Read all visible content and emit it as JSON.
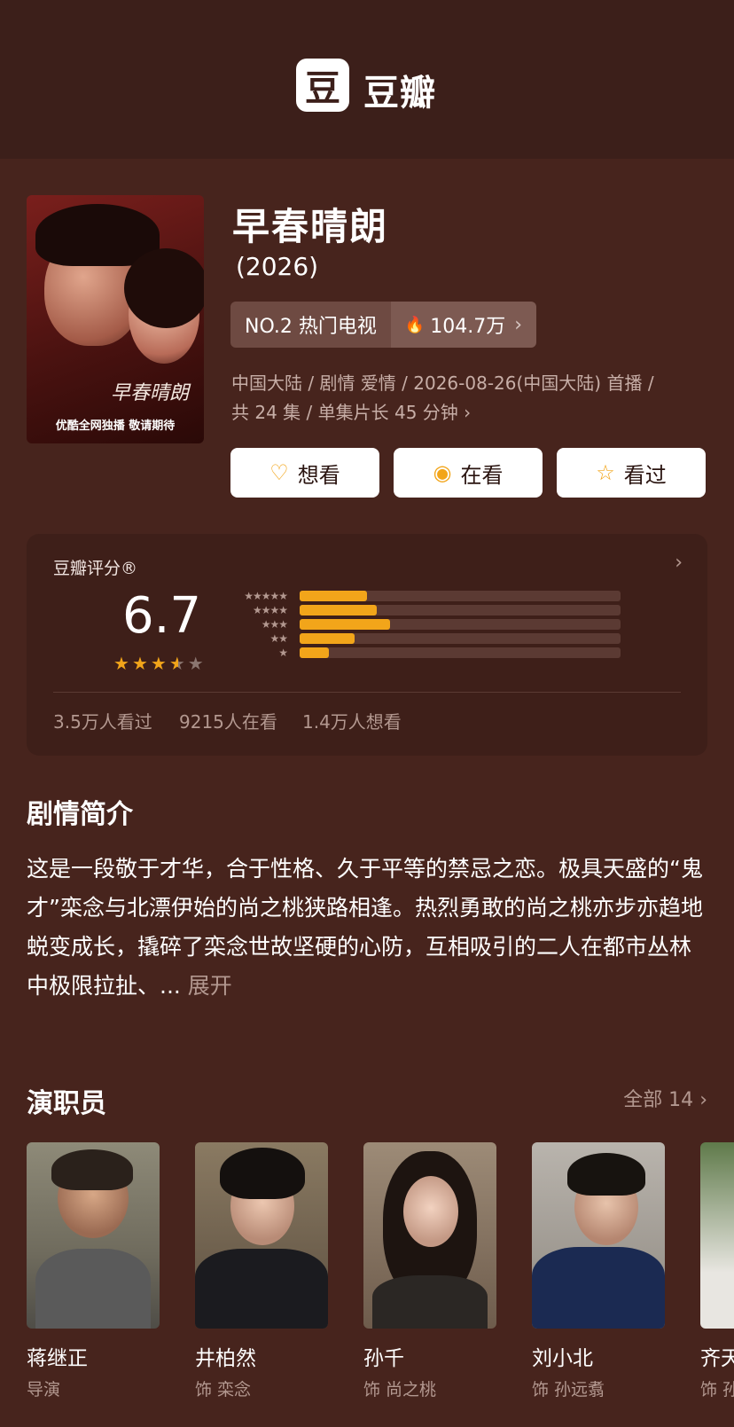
{
  "header": {
    "logo_glyph": "豆",
    "logo_text": "豆瓣"
  },
  "movie": {
    "poster": {
      "title_art": "早春晴朗",
      "tagline": "优酷全网独播 敬请期待"
    },
    "title": "早春晴朗",
    "year": "(2026)",
    "rank": "NO.2 热门电视",
    "heat": "104.7万",
    "meta_line1": "中国大陆 / 剧情 爱情 / 2026-08-26(中国大陆) 首播 /",
    "meta_line2": "共 24 集 / 单集片长 45 分钟",
    "buttons": [
      {
        "label": "想看",
        "icon": "heart-plus-icon"
      },
      {
        "label": "在看",
        "icon": "target-icon"
      },
      {
        "label": "看过",
        "icon": "star-outline-icon"
      }
    ]
  },
  "rating": {
    "label": "豆瓣评分®",
    "score": "6.7",
    "stars_value": 3.5,
    "distribution": [
      {
        "stars": "★★★★★",
        "fraction": 0.21
      },
      {
        "stars": "★★★★",
        "fraction": 0.24
      },
      {
        "stars": "★★★",
        "fraction": 0.28
      },
      {
        "stars": "★★",
        "fraction": 0.17
      },
      {
        "stars": "★",
        "fraction": 0.09
      }
    ],
    "stats": [
      "3.5万人看过",
      "9215人在看",
      "1.4万人想看"
    ]
  },
  "synopsis": {
    "heading": "剧情简介",
    "text": "这是一段敬于才华，合于性格、久于平等的禁忌之恋。极具天盛的“鬼才”栾念与北漂伊始的尚之桃狭路相逢。热烈勇敢的尚之桃亦步亦趋地蜕变成长，撬碎了栾念世故坚硬的心防，互相吸引的二人在都市丛林中极限拉扯、... ",
    "more": "展开"
  },
  "cast": {
    "heading": "演职员",
    "all_label": "全部 14",
    "members": [
      {
        "name": "蒋继正",
        "role": "导演"
      },
      {
        "name": "井柏然",
        "role": "饰 栾念"
      },
      {
        "name": "孙千",
        "role": "饰 尚之桃"
      },
      {
        "name": "刘小北",
        "role": "饰 孙远翥"
      },
      {
        "name": "齐天",
        "role": "饰 孙"
      }
    ]
  },
  "colors": {
    "background": "#47241d",
    "header": "#3c1f1a",
    "accent": "#f2a51a"
  }
}
